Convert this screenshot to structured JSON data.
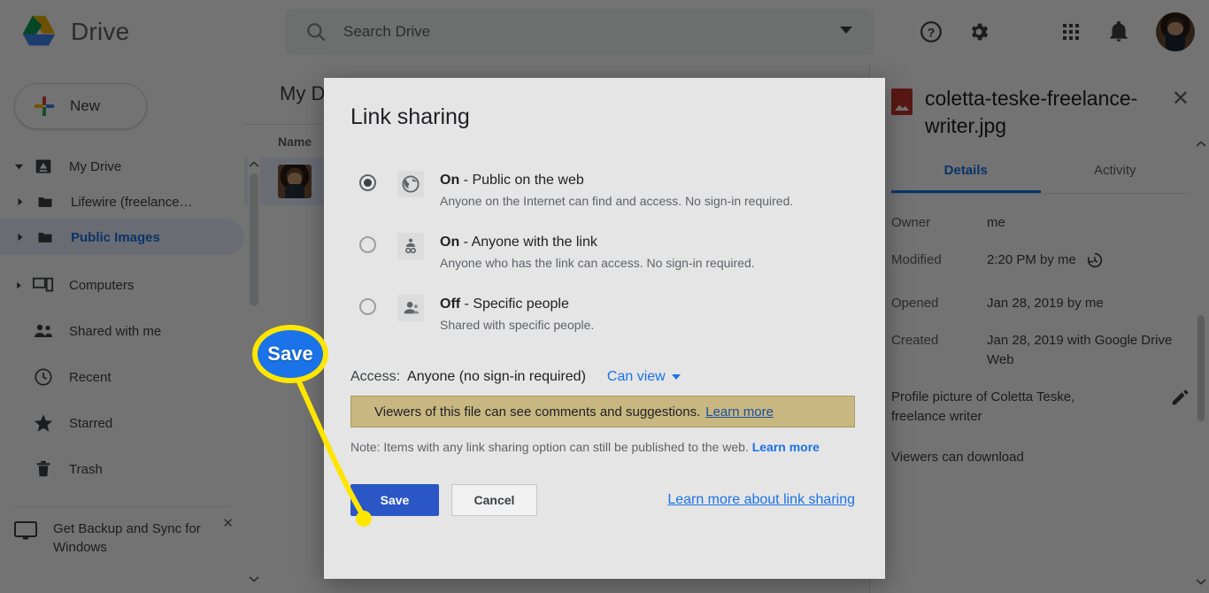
{
  "app": {
    "brand": "Drive",
    "logo_icon": "google-drive-logo"
  },
  "search": {
    "placeholder": "Search Drive",
    "icon": "search-icon",
    "caret_icon": "chevron-down-icon"
  },
  "topbar_icons": [
    {
      "name": "help-icon",
      "glyph": "?"
    },
    {
      "name": "settings-gear-icon",
      "glyph": "gear"
    },
    {
      "name": "apps-grid-icon",
      "glyph": "grid"
    },
    {
      "name": "notifications-bell-icon",
      "glyph": "bell"
    }
  ],
  "account": {
    "avatar_alt": "user-avatar"
  },
  "sidebar": {
    "new_button": {
      "label": "New",
      "icon": "plus-icon"
    },
    "items": [
      {
        "label": "My Drive",
        "icon": "drive-icon",
        "expander": "caret-down",
        "level": 0,
        "active": false
      },
      {
        "label": "Lifewire (freelance…",
        "icon": "folder-icon",
        "expander": "caret-right",
        "level": 1,
        "active": false
      },
      {
        "label": "Public Images",
        "icon": "folder-icon",
        "expander": "caret-right",
        "level": 1,
        "active": true
      },
      {
        "label": "Computers",
        "icon": "computer-icon",
        "expander": "caret-right",
        "level": 0,
        "active": false
      },
      {
        "label": "Shared with me",
        "icon": "people-icon",
        "expander": "",
        "level": 0,
        "active": false
      },
      {
        "label": "Recent",
        "icon": "clock-icon",
        "expander": "",
        "level": 0,
        "active": false
      },
      {
        "label": "Starred",
        "icon": "star-icon",
        "expander": "",
        "level": 0,
        "active": false
      },
      {
        "label": "Trash",
        "icon": "trash-icon",
        "expander": "",
        "level": 0,
        "active": false
      }
    ],
    "backup_promo": {
      "label": "Get Backup and Sync for Windows",
      "icon": "monitor-icon",
      "close_icon": "close-icon"
    }
  },
  "content": {
    "breadcrumb": "My Drive",
    "column_header_name": "Name",
    "toolbar_icons": [
      {
        "name": "share-person-icon"
      },
      {
        "name": "preview-eye-icon"
      },
      {
        "name": "trash-icon"
      },
      {
        "name": "more-vertical-icon"
      },
      {
        "name": "grid-view-icon"
      },
      {
        "name": "details-info-icon"
      }
    ],
    "scroll_up_icon": "chevron-up-icon",
    "scroll_down_icon": "chevron-down-icon"
  },
  "details_panel": {
    "file_icon": "jpg-image-file-icon",
    "file_name": "coletta-teske-freelance-writer.jpg",
    "close_icon": "close-icon",
    "tabs": [
      {
        "label": "Details",
        "selected": true
      },
      {
        "label": "Activity",
        "selected": false
      }
    ],
    "rows": [
      {
        "key": "Owner",
        "value": "me",
        "icon": ""
      },
      {
        "key": "Modified",
        "value": "2:20 PM by me",
        "icon": "version-history-icon"
      },
      {
        "key": "Opened",
        "value": "Jan 28, 2019 by me",
        "icon": ""
      },
      {
        "key": "Created",
        "value": "Jan 28, 2019 with Google Drive Web",
        "icon": ""
      }
    ],
    "description": "Profile picture of Coletta Teske, freelance writer",
    "description_edit_icon": "pencil-icon",
    "footer_note": "Viewers can download",
    "scroll_up_icon": "chevron-up-icon",
    "scroll_down_icon": "chevron-down-icon"
  },
  "modal": {
    "title": "Link sharing",
    "options": [
      {
        "state_label": "On",
        "separator": " - ",
        "title": "Public on the web",
        "description": "Anyone on the Internet can find and access. No sign-in required.",
        "icon": "globe-icon",
        "selected": true
      },
      {
        "state_label": "On",
        "separator": " - ",
        "title": "Anyone with the link",
        "description": "Anyone who has the link can access. No sign-in required.",
        "icon": "person-link-icon",
        "selected": false
      },
      {
        "state_label": "Off",
        "separator": " - ",
        "title": "Specific people",
        "description": "Shared with specific people.",
        "icon": "person-icon",
        "selected": false
      }
    ],
    "access": {
      "label": "Access:",
      "value": "Anyone (no sign-in required)",
      "permission": "Can view",
      "caret_icon": "chevron-down-icon"
    },
    "warning": {
      "text": "Viewers of this file can see comments and suggestions.",
      "link": "Learn more"
    },
    "note": {
      "text": "Note: Items with any link sharing option can still be published to the web.",
      "link": "Learn more"
    },
    "buttons": {
      "save": "Save",
      "cancel": "Cancel",
      "learn_more": "Learn more about link sharing"
    }
  },
  "callout": {
    "label": "Save",
    "badge_color": "#1a73e8",
    "ring_color": "#ffe600",
    "line_color": "#ffe600"
  }
}
